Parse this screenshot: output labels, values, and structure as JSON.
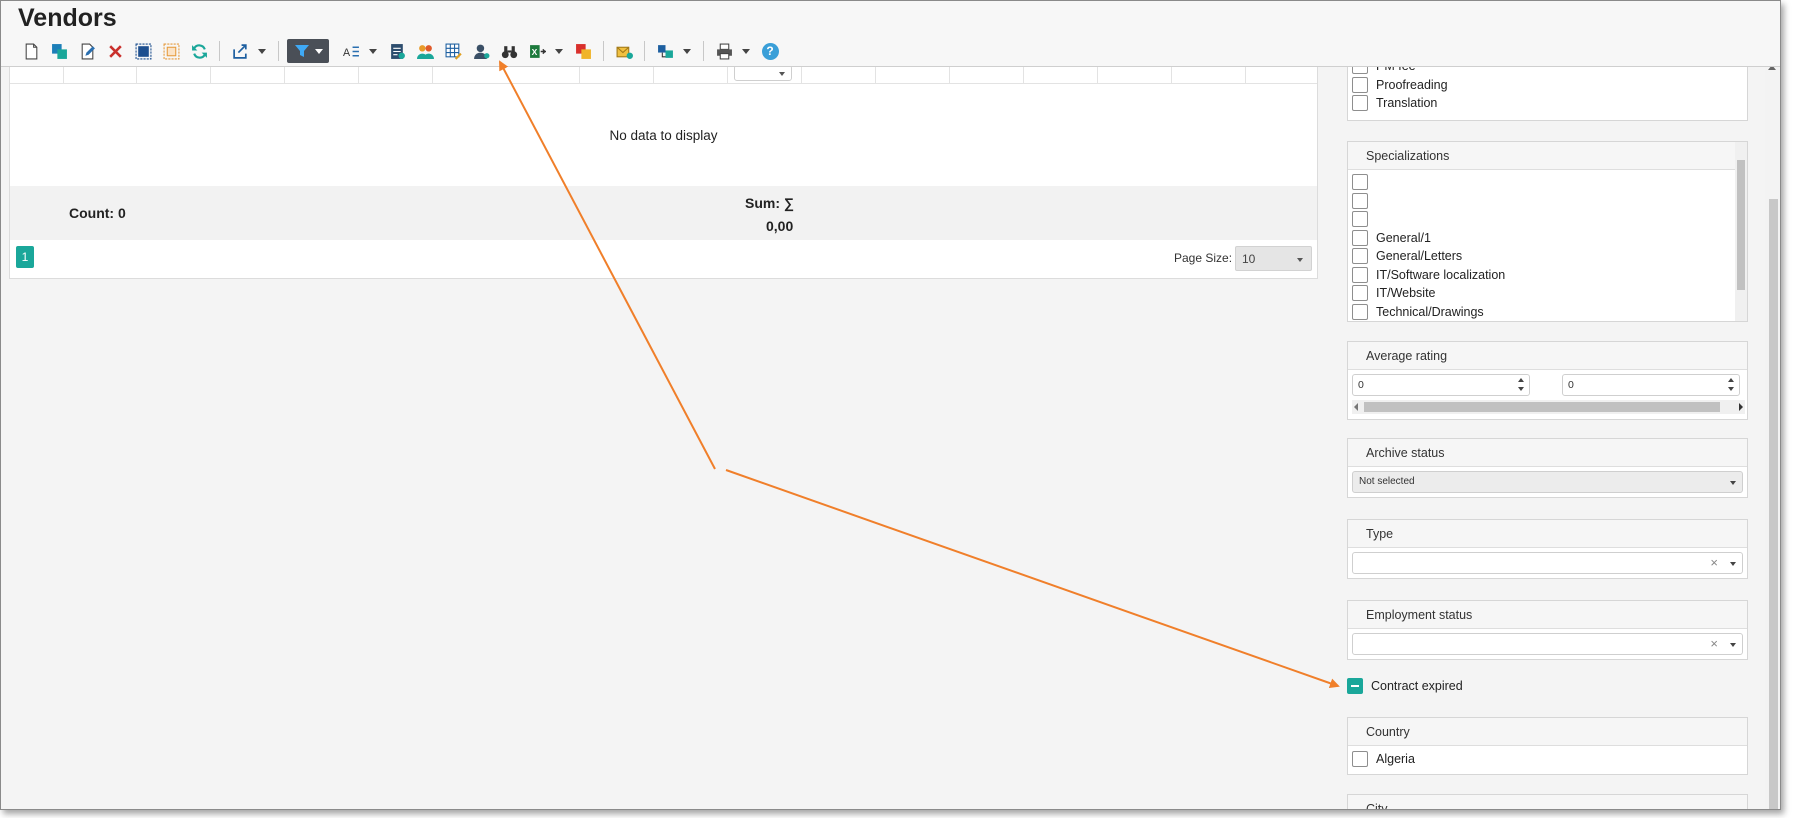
{
  "window": {
    "title": "Vendors"
  },
  "toolbar": {
    "icons": [
      "new-icon",
      "copy-icon",
      "edit-icon",
      "delete-icon",
      "select-all-icon",
      "deselect-icon",
      "refresh-icon",
      "export-icon",
      "filter-icon",
      "text-format-icon",
      "report-icon",
      "users-icon",
      "grid-settings-icon",
      "user-pin-icon",
      "binoculars-icon",
      "excel-icon",
      "color-icon",
      "mail-merge-icon",
      "flow-icon",
      "print-icon",
      "help-icon"
    ],
    "help_label": "?"
  },
  "grid": {
    "filter_label": "filter",
    "empty_text": "No data to display",
    "count_label": "Count: 0",
    "sum_label": "Sum: ∑",
    "sum_value": "0,00",
    "pager": {
      "current_page": "1",
      "page_size_label": "Page Size:",
      "page_size_value": "10"
    }
  },
  "filters": {
    "services": [
      "PM fee",
      "Proofreading",
      "Translation"
    ],
    "specializations": {
      "title": "Specializations",
      "items": [
        "",
        "",
        "",
        "General/1",
        "General/Letters",
        "IT/Software localization",
        "IT/Website",
        "Technical/Drawings"
      ]
    },
    "average_rating": {
      "title": "Average rating",
      "min": "0",
      "max": "0"
    },
    "archive_status": {
      "title": "Archive status",
      "value": "Not selected"
    },
    "type": {
      "title": "Type",
      "value": ""
    },
    "employment_status": {
      "title": "Employment status",
      "value": ""
    },
    "contract_expired": {
      "label": "Contract expired",
      "state": "indeterminate"
    },
    "country": {
      "title": "Country",
      "items": [
        "Algeria"
      ]
    },
    "city": {
      "title": "City"
    }
  },
  "annotation": {
    "color": "#f07f2a"
  }
}
